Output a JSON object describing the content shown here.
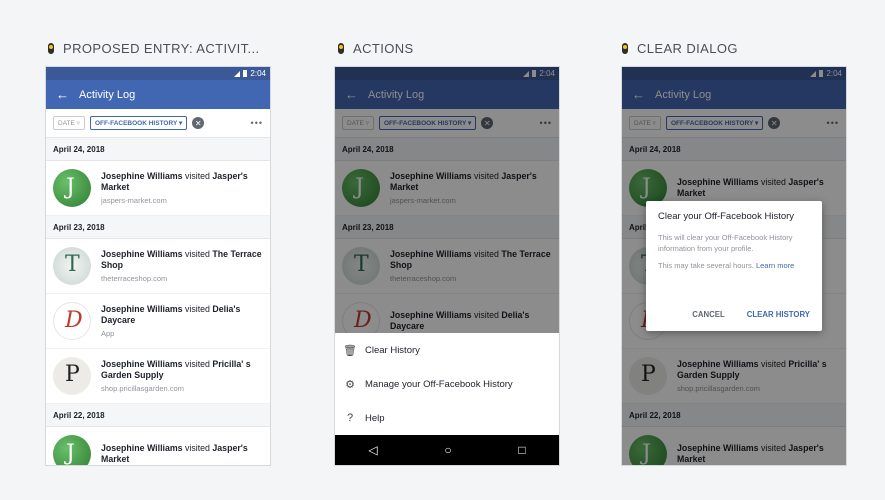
{
  "panels": [
    {
      "title": "PROPOSED ENTRY: ACTIVIT..."
    },
    {
      "title": "ACTIONS"
    },
    {
      "title": "CLEAR DIALOG"
    }
  ],
  "phone": {
    "time": "2:04",
    "appbar_title": "Activity Log",
    "filters": {
      "date": "DATE",
      "off_facebook": "OFF-FACEBOOK HISTORY"
    },
    "more_label": "•••",
    "groups": [
      {
        "date": "April 24, 2018",
        "items": [
          {
            "who": "Josephine Williams",
            "verb": " visited ",
            "where": "Jasper's Market",
            "sub": "jaspers-market.com"
          }
        ]
      },
      {
        "date": "April 23, 2018",
        "items": [
          {
            "who": "Josephine Williams",
            "verb": " visited ",
            "where": "The Terrace Shop",
            "sub": "theterraceshop.com"
          },
          {
            "who": "Josephine Williams",
            "verb": " visited ",
            "where": "Delia's Daycare",
            "sub": "App"
          },
          {
            "who": "Josephine Williams",
            "verb": " visited ",
            "where": "Pricilla' s Garden Supply",
            "sub": "shop.pricillasgarden.com"
          }
        ]
      },
      {
        "date": "April 22, 2018",
        "items": [
          {
            "who": "Josephine Williams",
            "verb": " visited ",
            "where": "Jasper's Market",
            "sub": ""
          }
        ]
      }
    ]
  },
  "actions_sheet": {
    "items": [
      {
        "label": "Clear History",
        "icon": "trash-icon"
      },
      {
        "label": "Manage your Off-Facebook History",
        "icon": "gear-icon"
      },
      {
        "label": "Help",
        "icon": "help-icon"
      }
    ]
  },
  "dialog": {
    "title": "Clear your Off-Facebook History",
    "body": "This will clear your Off-Facebook History information from your profile.",
    "body2_prefix": "This may take several hours. ",
    "body2_link": "Learn more",
    "cancel": "CANCEL",
    "clear": "CLEAR HISTORY"
  },
  "colors": {
    "facebook_blue": "#4267b2",
    "status_blue": "#3b5998"
  }
}
